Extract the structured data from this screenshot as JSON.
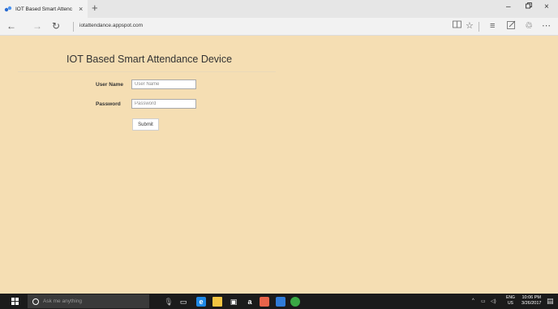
{
  "browser": {
    "tab_title": "IOT Based Smart Attenc",
    "tab_close": "×",
    "new_tab": "+",
    "window_min": "–",
    "window_max": "▫",
    "window_close": "×",
    "address": "iotattendance.appspot.com",
    "back": "←",
    "forward": "→",
    "refresh": "↻"
  },
  "page": {
    "title": "IOT Based Smart Attendance Device",
    "form": {
      "username_label": "User Name",
      "username_placeholder": "User Name",
      "username_value": "",
      "password_label": "Password",
      "password_placeholder": "Password",
      "password_value": "",
      "submit_label": "Submit"
    }
  },
  "taskbar": {
    "search_placeholder": "Ask me anything",
    "language": "ENG",
    "region": "US",
    "time": "10:06 PM",
    "date": "3/26/2017"
  },
  "colors": {
    "page_background": "#f5deb3",
    "taskbar_background": "#1b1b1b",
    "edge_blue": "#1e88e5"
  }
}
